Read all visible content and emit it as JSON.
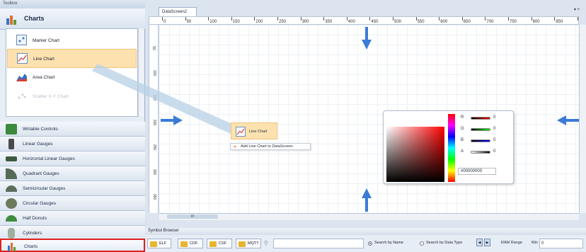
{
  "toolbox": {
    "title": "Toolbox",
    "pin": "▾ ⊞",
    "header": "Charts",
    "chart_items": [
      {
        "label": "Marker Chart",
        "icon": "marker-chart-icon"
      },
      {
        "label": "Line Chart",
        "icon": "line-chart-icon",
        "selected": true
      },
      {
        "label": "Area Chart",
        "icon": "area-chart-icon"
      },
      {
        "label": "Scatter X-Y Chart",
        "icon": "scatter-chart-icon",
        "disabled": true
      }
    ],
    "categories": [
      {
        "label": "Writable Controls",
        "icon": "writable-controls-icon",
        "color": "#3c8a3c"
      },
      {
        "label": "Linear Gauges",
        "icon": "linear-gauge-icon",
        "color": "#4a4a4a"
      },
      {
        "label": "Horizontal Linear Gauges",
        "icon": "horizontal-gauge-icon",
        "color": "#3d5a3d"
      },
      {
        "label": "Quadrant Gauges",
        "icon": "quadrant-gauge-icon",
        "color": "#556b55"
      },
      {
        "label": "Semicircular Gauges",
        "icon": "semicircular-gauge-icon",
        "color": "#5a6e5a"
      },
      {
        "label": "Circular Gauges",
        "icon": "circular-gauge-icon",
        "color": "#6b7b5b"
      },
      {
        "label": "Half Donuts",
        "icon": "half-donut-icon",
        "color": "#3f8c3f"
      },
      {
        "label": "Cylinders",
        "icon": "cylinder-icon",
        "color": "#9fb0a0"
      },
      {
        "label": "Charts",
        "icon": "charts-icon",
        "color": "#d9682b",
        "active": true
      }
    ]
  },
  "workspace": {
    "tab": "DataScreen2",
    "close": "▾ ×",
    "ruler_top": [
      "0",
      "50",
      "100",
      "150",
      "200",
      "250",
      "300",
      "350",
      "400",
      "450",
      "500",
      "550",
      "600",
      "650",
      "700",
      "750",
      "800",
      "850",
      "900"
    ],
    "ruler_left": [
      "50",
      "100",
      "150",
      "200",
      "250",
      "300",
      "350"
    ],
    "hscroll_thumb": "III"
  },
  "drag": {
    "item_label": "Line Chart",
    "tooltip": "Add Line Chart to DataScreen."
  },
  "color_picker": {
    "channels": [
      {
        "name": "R",
        "value": "0"
      },
      {
        "name": "G",
        "value": "0"
      },
      {
        "name": "B",
        "value": "0"
      },
      {
        "name": "A",
        "value": "0"
      }
    ],
    "hex": "#00000000"
  },
  "symbol_browser": {
    "title": "Symbol Browser",
    "buttons": [
      "ELF",
      "CDF",
      "CSF",
      "MQTT"
    ],
    "search_by_name": "Search by Name",
    "search_by_type": "Search by Data Type",
    "ram_range": "RAM Range",
    "min_label": "Min",
    "min_value": "0"
  },
  "colors": {
    "accent": "#3a7bd5",
    "selection": "#fde2b0",
    "active_border": "#e0201c"
  }
}
